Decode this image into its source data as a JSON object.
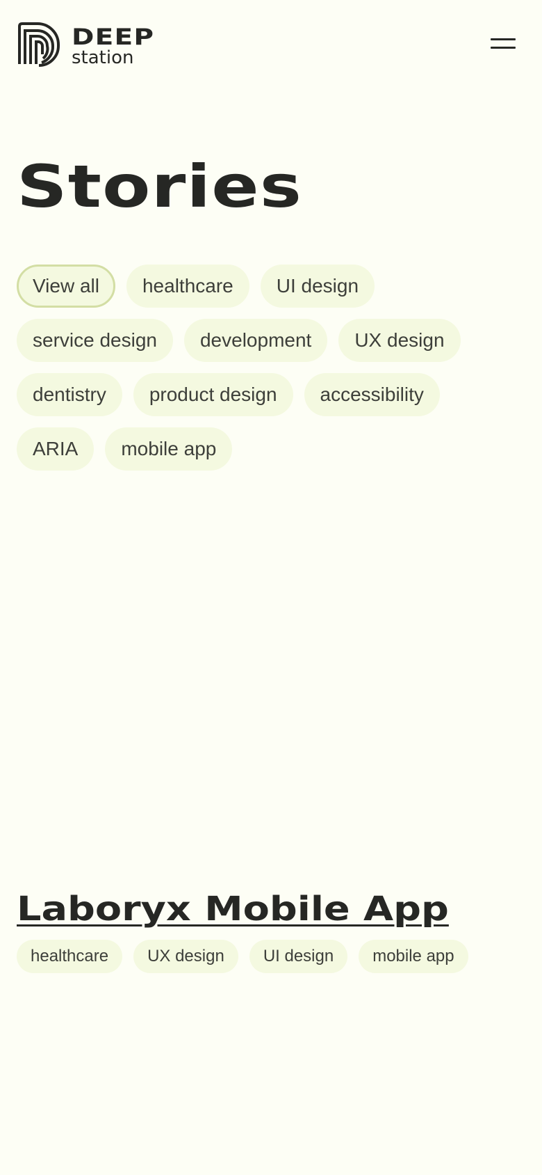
{
  "brand": {
    "name_line_1": "DEEP",
    "name_line_2": "station",
    "logo_icon": "deep-station-arches-logo"
  },
  "header": {
    "menu_icon": "hamburger-menu-icon"
  },
  "page": {
    "title": "Stories"
  },
  "filters": {
    "active": "View all",
    "rows": [
      [
        "View all",
        "healthcare",
        "UI design"
      ],
      [
        "service design",
        "development",
        "UX design"
      ],
      [
        "dentistry",
        "product design",
        "accessibility"
      ],
      [
        "ARIA",
        "mobile app"
      ]
    ]
  },
  "story": {
    "title": "Laboryx Mobile App",
    "tags": [
      "healthcare",
      "UX design",
      "UI design",
      "mobile app"
    ]
  },
  "colors": {
    "background": "#fdfef5",
    "text": "#262724",
    "chip_background": "#f4f9e0",
    "chip_active_border": "#d3dea4"
  }
}
